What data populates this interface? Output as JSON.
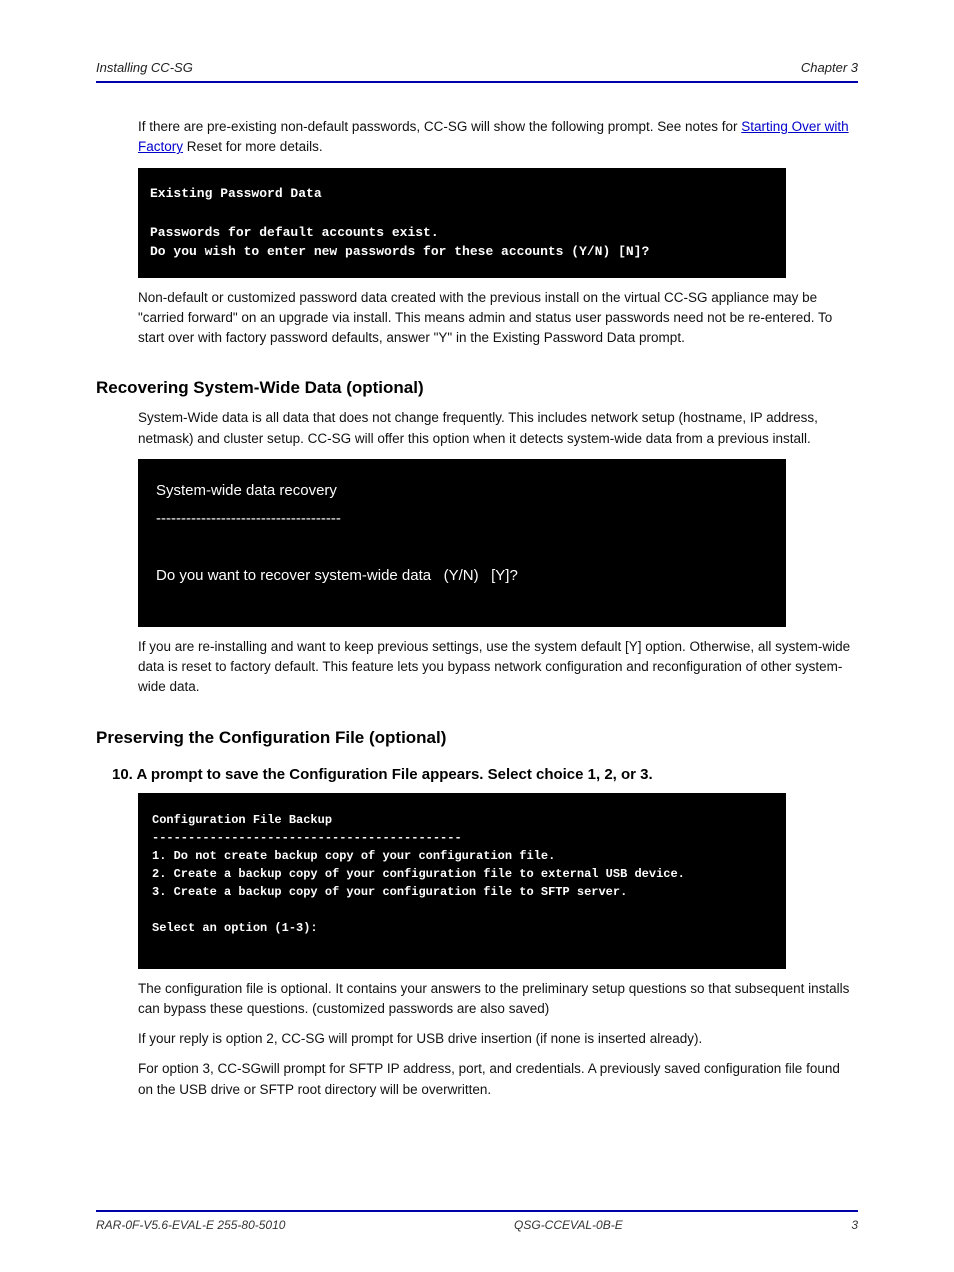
{
  "header": {
    "left": "Installing CC-SG",
    "right": "Chapter 3"
  },
  "step9_lead": "If there are pre-existing non-default passwords, CC-SG will show the following prompt. See notes for",
  "step9_link": "Starting Over with Factory",
  "step9_tail": "Reset for more details.",
  "term1": {
    "title": "Existing Password Data",
    "line1": "Passwords for default accounts exist.",
    "line2": "Do you wish to enter new passwords for these accounts (Y/N) [N]?"
  },
  "para_custom": "Non-default or customized password data created with the previous install on the virtual CC-SG appliance may be \"carried forward\" on an upgrade via install. This means admin and status user passwords need not be re-entered. To start over with factory password defaults, answer \"Y\" in the Existing Password Data prompt.",
  "h_recover": "Recovering System-Wide Data (optional)",
  "para_recover": "System-Wide data is all data that does not change frequently. This includes network setup (hostname, IP address, netmask) and cluster setup. CC-SG will offer this option when it detects system-wide data from a previous install.",
  "term2": {
    "title": "System-wide data recovery",
    "hr": "-------------------------------------",
    "line1": "Do you want to recover system-wide data   (Y/N)   [Y]?"
  },
  "para_sysdef": "If you are re-installing and want to keep previous settings, use the system default [Y] option. Otherwise, all system-wide data is reset to factory default. This feature lets you bypass network configuration and reconfiguration of other system-wide data.",
  "h_preserve": "Preserving the Configuration File (optional)",
  "step10": "10. A prompt to save the Configuration File appears. Select choice 1, 2, or 3.",
  "term3": {
    "title": "Configuration File Backup",
    "hr": "-------------------------------------------",
    "opt1": "1. Do not create backup copy of your configuration file.",
    "opt2": "2. Create a backup copy of your configuration file to external USB device.",
    "opt3": "3. Create a backup copy of your configuration file to SFTP server.",
    "select": "Select an option (1-3):"
  },
  "para_cfg1": "The configuration file is optional. It contains your answers to the preliminary setup questions so that subsequent installs can bypass these questions. (customized passwords are also saved)",
  "para_cfg2": "If your reply is option 2, CC-SG will prompt for USB drive insertion (if none is inserted already).",
  "para_cfg3": "For option 3, CC-SGwill prompt for SFTP IP address, port, and credentials. A previously saved configuration file found on the USB drive or SFTP root directory will be overwritten.",
  "footer": {
    "left": "RAR-0F-V5.6-EVAL-E  255-80-5010",
    "center": "QSG-CCEVAL-0B-E",
    "right": "3"
  }
}
